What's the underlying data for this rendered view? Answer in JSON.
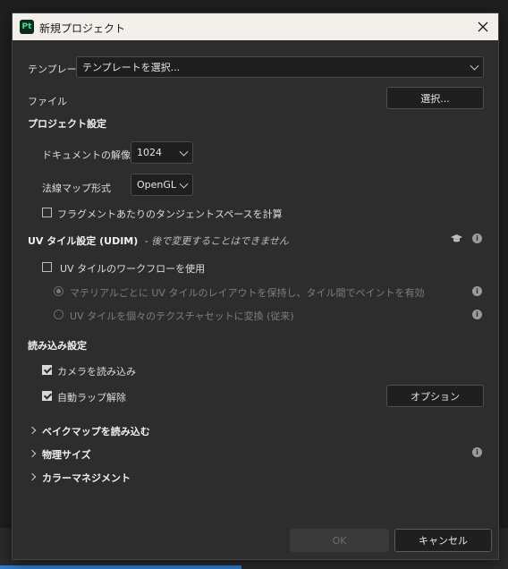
{
  "window": {
    "title": "新規プロジェクト",
    "app_icon_text": "Pt",
    "close_glyph": "✕"
  },
  "template": {
    "label": "テンプレート",
    "value": "テンプレートを選択..."
  },
  "file": {
    "label": "ファイル",
    "button": "選択..."
  },
  "project_settings": {
    "header": "プロジェクト設定",
    "resolution_label": "ドキュメントの解像度",
    "resolution_value": "1024",
    "normal_map_label": "法線マップ形式",
    "normal_map_value": "OpenGL",
    "tangent_label": "フラグメントあたりのタンジェントスペースを計算",
    "tangent_checked": false
  },
  "uv_settings": {
    "header": "UV タイル設定 (UDIM)",
    "note": "- 後で変更することはできません",
    "workflow_label": "UV タイルのワークフローを使用",
    "workflow_checked": false,
    "option1": "マテリアルごとに UV タイルのレイアウトを保持し、タイル間でペイントを有効",
    "option2": "UV タイルを個々のテクスチャセットに変換 (従来)",
    "info_glyph": "i",
    "learn_icon": "graduation-cap-icon"
  },
  "import_settings": {
    "header": "読み込み設定",
    "camera_label": "カメラを読み込み",
    "camera_checked": true,
    "unwrap_label": "自動ラップ解除",
    "unwrap_checked": true,
    "options_button": "オプション"
  },
  "sections": {
    "bake": "ベイクマップを読み込む",
    "physical": "物理サイズ",
    "color": "カラーマネジメント"
  },
  "footer": {
    "ok": "OK",
    "cancel": "キャンセル"
  },
  "colors": {
    "titlebar_bg": "#f3f0ec",
    "dialog_bg": "#2d2d2d",
    "app_icon_bg": "#0c2b1c",
    "app_icon_fg": "#3ee08a",
    "progress": "#2f7fd6"
  }
}
